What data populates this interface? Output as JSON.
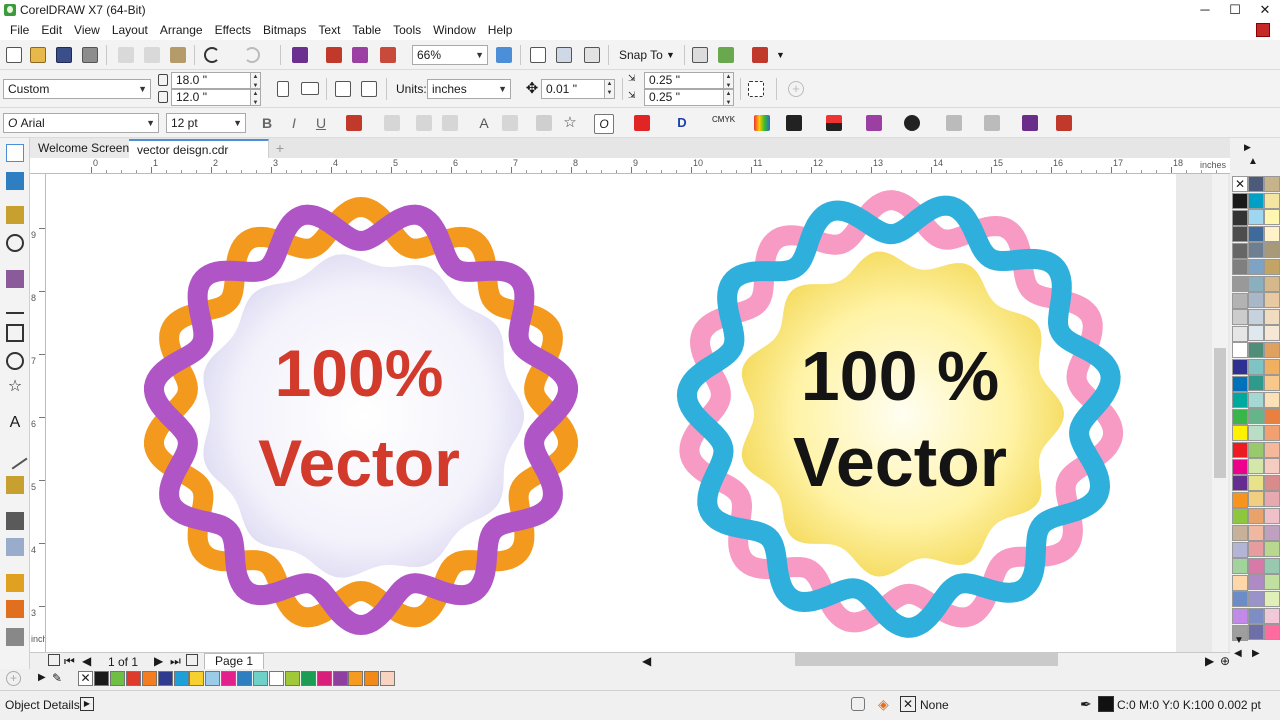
{
  "window": {
    "title": "CorelDRAW X7 (64-Bit)",
    "min": "─",
    "max": "☐",
    "close": "✕"
  },
  "menu": [
    "File",
    "Edit",
    "View",
    "Layout",
    "Arrange",
    "Effects",
    "Bitmaps",
    "Text",
    "Table",
    "Tools",
    "Window",
    "Help"
  ],
  "toolbar": {
    "zoom": "66%",
    "snap": "Snap To"
  },
  "property_bar": {
    "page_preset": "Custom",
    "width": "18.0 \"",
    "height": "12.0 \"",
    "units_label": "Units:",
    "units": "inches",
    "nudge": "0.01 \"",
    "dup_x": "0.25 \"",
    "dup_y": "0.25 \""
  },
  "text_bar": {
    "font": "Arial",
    "size": "12 pt"
  },
  "tabs": [
    {
      "label": "Welcome Screen"
    },
    {
      "label": "vector deisgn.cdr"
    }
  ],
  "ruler": {
    "h_ticks": [
      "0",
      "1",
      "2",
      "3",
      "4",
      "5",
      "6",
      "7",
      "8",
      "9",
      "10",
      "11",
      "12",
      "13",
      "14",
      "15",
      "16",
      "17",
      "18"
    ],
    "unit": "inches",
    "v_ticks": [
      "9",
      "8",
      "7",
      "6",
      "5",
      "4",
      "3"
    ]
  },
  "canvas": {
    "badge_left": {
      "line1": "100%",
      "line2": "Vector",
      "text_color": "#d23a2b"
    },
    "badge_right": {
      "line1": "100 %",
      "line2": "Vector",
      "text_color": "#141414"
    }
  },
  "pagebar": {
    "page_count": "1 of 1",
    "page_tab": "Page 1"
  },
  "status": {
    "object_details": "Object Details",
    "fill": "None",
    "outline": "C:0 M:0 Y:0 K:100  0.002 pt"
  },
  "colors": {
    "palette_col1": [
      "#1a1a1a",
      "#333333",
      "#4d4d4d",
      "#666666",
      "#7f7f7f",
      "#999999",
      "#b3b3b3",
      "#cccccc",
      "#e6e6e6",
      "#ffffff",
      "#2e3192",
      "#0072bc",
      "#00a99d",
      "#39b54a",
      "#fff200",
      "#ed1c24",
      "#ec008c",
      "#662d91",
      "#f7941d",
      "#8dc63f",
      "#c7b299",
      "#b4b4d4",
      "#a3d39c",
      "#ffd7a8",
      "#6b8cc7",
      "#c28ae8",
      "#9e9e9e",
      "#5a6e9c"
    ],
    "palette_col2": [
      "#4a5a78",
      "#00a0c6",
      "#9fd6f0",
      "#3e6b9c",
      "#6e7f92",
      "#7fa3c4",
      "#8ab0bf",
      "#a9b8c9",
      "#c6d3df",
      "#dfe8ef",
      "#4f8f7a",
      "#7ec4c4",
      "#2d9a8b",
      "#a3d8d3",
      "#66b58a",
      "#b8dfc6",
      "#99c96d",
      "#d3e8a8",
      "#e8e288",
      "#f0d080",
      "#e9a36a",
      "#f0b8a0",
      "#e79ca0",
      "#d87aa8",
      "#b08ac5",
      "#9a93c9",
      "#7d8ec4",
      "#6f6fa8"
    ],
    "palette_col3": [
      "#c6b38a",
      "#f4e6a0",
      "#fff7b0",
      "#fff2c8",
      "#a89a78",
      "#c2a565",
      "#d6b98a",
      "#e8c9a2",
      "#f2dcc0",
      "#f7e8d6",
      "#e0a060",
      "#f0b060",
      "#f7c88a",
      "#fbe0b8",
      "#e88040",
      "#f2a070",
      "#f5b89a",
      "#f7ccc0",
      "#d98a8a",
      "#e8a8b0",
      "#f0c0c8",
      "#c0a0c0",
      "#b8d890",
      "#98c8b0",
      "#c0e0a0",
      "#e0f0b8",
      "#f0c8d8",
      "#ff6aa0"
    ],
    "doc_palette": [
      "#1a1a1a",
      "#6fbf44",
      "#e03a2c",
      "#f47d20",
      "#2f3b8f",
      "#1e9fd8",
      "#f5d02f",
      "#9ccbe8",
      "#e3208b",
      "#2e7fc1",
      "#6fd0c8",
      "#ffffff",
      "#a0c838",
      "#1b9e53",
      "#d8207a",
      "#8e3fa0",
      "#f59b21",
      "#f28a17",
      "#f9d2c0"
    ]
  }
}
